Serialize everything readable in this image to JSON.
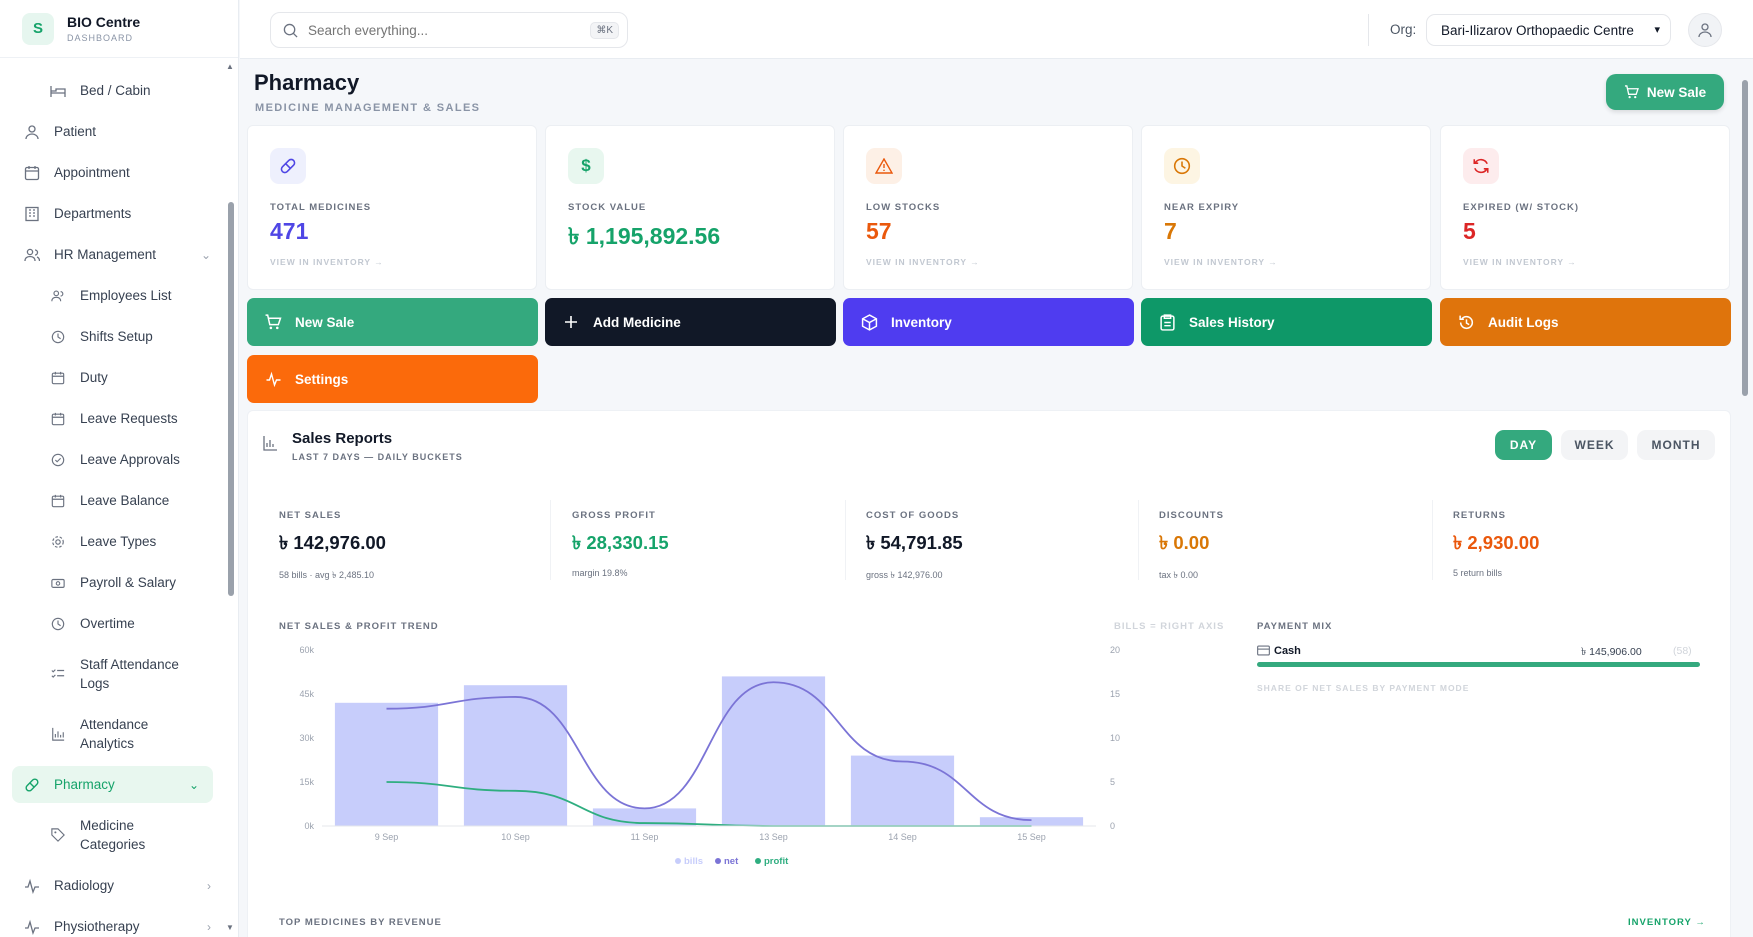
{
  "brand": {
    "title": "BIO Centre",
    "subtitle": "DASHBOARD",
    "logo": "S"
  },
  "sidebar": {
    "items": [
      {
        "label": "Bed / Cabin",
        "icon": "bed-icon"
      },
      {
        "label": "Patient",
        "icon": "user-icon"
      },
      {
        "label": "Appointment",
        "icon": "calendar-icon"
      },
      {
        "label": "Departments",
        "icon": "building-icon"
      },
      {
        "label": "HR Management",
        "icon": "users-icon"
      },
      {
        "label": "Employees List",
        "icon": "users-icon"
      },
      {
        "label": "Shifts Setup",
        "icon": "clock-icon"
      },
      {
        "label": "Duty",
        "icon": "calendar-icon"
      },
      {
        "label": "Leave Requests",
        "icon": "calendar-icon"
      },
      {
        "label": "Leave Approvals",
        "icon": "check-circle-icon"
      },
      {
        "label": "Leave Balance",
        "icon": "calendar-icon"
      },
      {
        "label": "Leave Types",
        "icon": "gear-icon"
      },
      {
        "label": "Payroll & Salary",
        "icon": "money-icon"
      },
      {
        "label": "Overtime",
        "icon": "clock-icon"
      },
      {
        "label": "Staff Attendance Logs",
        "icon": "list-icon"
      },
      {
        "label": "Attendance Analytics",
        "icon": "bar-chart-icon"
      },
      {
        "label": "Pharmacy",
        "icon": "pill-icon"
      },
      {
        "label": "Medicine Categories",
        "icon": "tag-icon"
      },
      {
        "label": "Radiology",
        "icon": "pulse-icon"
      },
      {
        "label": "Physiotherapy",
        "icon": "pulse-icon"
      }
    ]
  },
  "topbar": {
    "search_placeholder": "Search everything...",
    "shortcut": "⌘K",
    "org_label": "Org:",
    "org_value": "Bari-Ilizarov Orthopaedic Centre"
  },
  "page": {
    "title": "Pharmacy",
    "subtitle": "MEDICINE MANAGEMENT & SALES",
    "new_sale": "New Sale"
  },
  "stats": [
    {
      "label": "TOTAL MEDICINES",
      "value": "471",
      "link": "VIEW IN INVENTORY →",
      "color": "#4f46e5"
    },
    {
      "label": "STOCK VALUE",
      "value": "৳ 1,195,892.56",
      "color": "#16a36a"
    },
    {
      "label": "LOW STOCKS",
      "value": "57",
      "link": "VIEW IN INVENTORY →",
      "color": "#ea580c"
    },
    {
      "label": "NEAR EXPIRY",
      "value": "7",
      "link": "VIEW IN INVENTORY →",
      "color": "#d97706"
    },
    {
      "label": "EXPIRED (W/ STOCK)",
      "value": "5",
      "link": "VIEW IN INVENTORY →",
      "color": "#dc2626"
    }
  ],
  "actions": [
    {
      "label": "New Sale",
      "color": "#34a97e"
    },
    {
      "label": "Add Medicine",
      "color": "#111827"
    },
    {
      "label": "Inventory",
      "color": "#4f3cf0"
    },
    {
      "label": "Sales History",
      "color": "#0e9868"
    },
    {
      "label": "Audit Logs",
      "color": "#df740c"
    },
    {
      "label": "Settings",
      "color": "#fb6a0b"
    }
  ],
  "report": {
    "title": "Sales Reports",
    "subtitle": "LAST 7 DAYS — DAILY BUCKETS",
    "tabs": [
      "DAY",
      "WEEK",
      "MONTH"
    ],
    "kpis": [
      {
        "label": "NET SALES",
        "value": "৳ 142,976.00",
        "sub": "58 bills · avg ৳ 2,485.10",
        "color": "#111827"
      },
      {
        "label": "GROSS PROFIT",
        "value": "৳ 28,330.15",
        "sub": "margin 19.8%",
        "color": "#16a36a"
      },
      {
        "label": "COST OF GOODS",
        "value": "৳ 54,791.85",
        "sub": "gross ৳ 142,976.00",
        "color": "#111827"
      },
      {
        "label": "DISCOUNTS",
        "value": "৳ 0.00",
        "sub": "tax ৳ 0.00",
        "color": "#d97706"
      },
      {
        "label": "RETURNS",
        "value": "৳ 2,930.00",
        "sub": "5 return bills",
        "color": "#ea580c"
      }
    ],
    "trend_label": "NET SALES & PROFIT TREND",
    "trend_note": "BILLS = RIGHT AXIS",
    "payment_label": "PAYMENT MIX",
    "payment": {
      "name": "Cash",
      "amount": "৳ 145,906.00",
      "count": "(58)"
    },
    "payment_note": "SHARE OF NET SALES BY PAYMENT MODE",
    "top_label": "TOP MEDICINES BY REVENUE",
    "top_link": "INVENTORY →"
  },
  "chart_data": {
    "type": "bar",
    "categories": [
      "9 Sep",
      "10 Sep",
      "11 Sep",
      "13 Sep",
      "14 Sep",
      "15 Sep"
    ],
    "yticks_left": [
      "0k",
      "15k",
      "30k",
      "45k",
      "60k"
    ],
    "yticks_right": [
      "0",
      "5",
      "10",
      "15",
      "20"
    ],
    "ylim": [
      0,
      60000
    ],
    "ylim_right": [
      0,
      20
    ],
    "series": [
      {
        "name": "bills",
        "type": "bar",
        "axis": "right",
        "values": [
          14,
          16,
          2,
          17,
          8,
          1
        ],
        "color": "#c7cdfb"
      },
      {
        "name": "net",
        "type": "line",
        "axis": "left",
        "values": [
          40000,
          44000,
          6000,
          49000,
          22000,
          2000
        ],
        "color": "#7b74d6"
      },
      {
        "name": "profit",
        "type": "line",
        "axis": "left",
        "values": [
          15000,
          12000,
          1000,
          0,
          0,
          0
        ],
        "color": "#2fae80"
      }
    ]
  }
}
